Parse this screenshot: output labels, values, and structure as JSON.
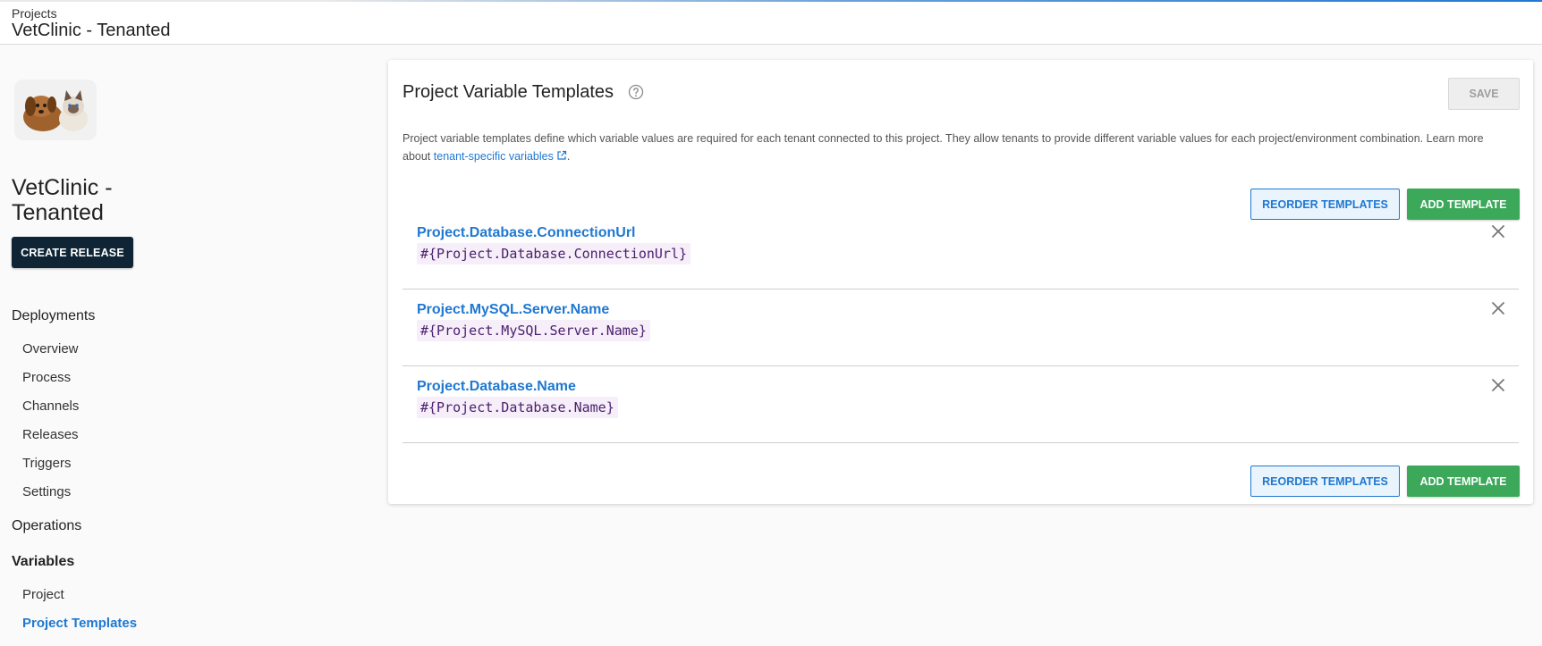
{
  "header": {
    "breadcrumb": "Projects",
    "title": "VetClinic - Tenanted"
  },
  "sidebar": {
    "project_name": "VetClinic - Tenanted",
    "create_release_label": "CREATE RELEASE",
    "sections": [
      {
        "label": "Deployments",
        "items": [
          "Overview",
          "Process",
          "Channels",
          "Releases",
          "Triggers",
          "Settings"
        ]
      },
      {
        "label": "Operations",
        "items": []
      },
      {
        "label": "Variables",
        "items": [
          "Project",
          "Project Templates"
        ]
      }
    ],
    "active_item": "Project Templates"
  },
  "card": {
    "title": "Project Variable Templates",
    "save_label": "SAVE",
    "description_prefix": "Project variable templates define which variable values are required for each tenant connected to this project. They allow tenants to provide different variable values for each project/environment combination. Learn more about ",
    "description_link": "tenant-specific variables",
    "description_suffix": ".",
    "reorder_label": "REORDER TEMPLATES",
    "add_label": "ADD TEMPLATE",
    "templates": [
      {
        "name": "Project.Database.ConnectionUrl",
        "expression": "#{Project.Database.ConnectionUrl}"
      },
      {
        "name": "Project.MySQL.Server.Name",
        "expression": "#{Project.MySQL.Server.Name}"
      },
      {
        "name": "Project.Database.Name",
        "expression": "#{Project.Database.Name}"
      }
    ]
  },
  "colors": {
    "accent": "#1f78d1",
    "success": "#3ba85a",
    "dark_button": "#0f2535",
    "expression_bg": "#f6eef8"
  },
  "icons": {
    "help": "help-circle-icon",
    "external_link": "external-link-icon",
    "remove": "close-icon"
  }
}
